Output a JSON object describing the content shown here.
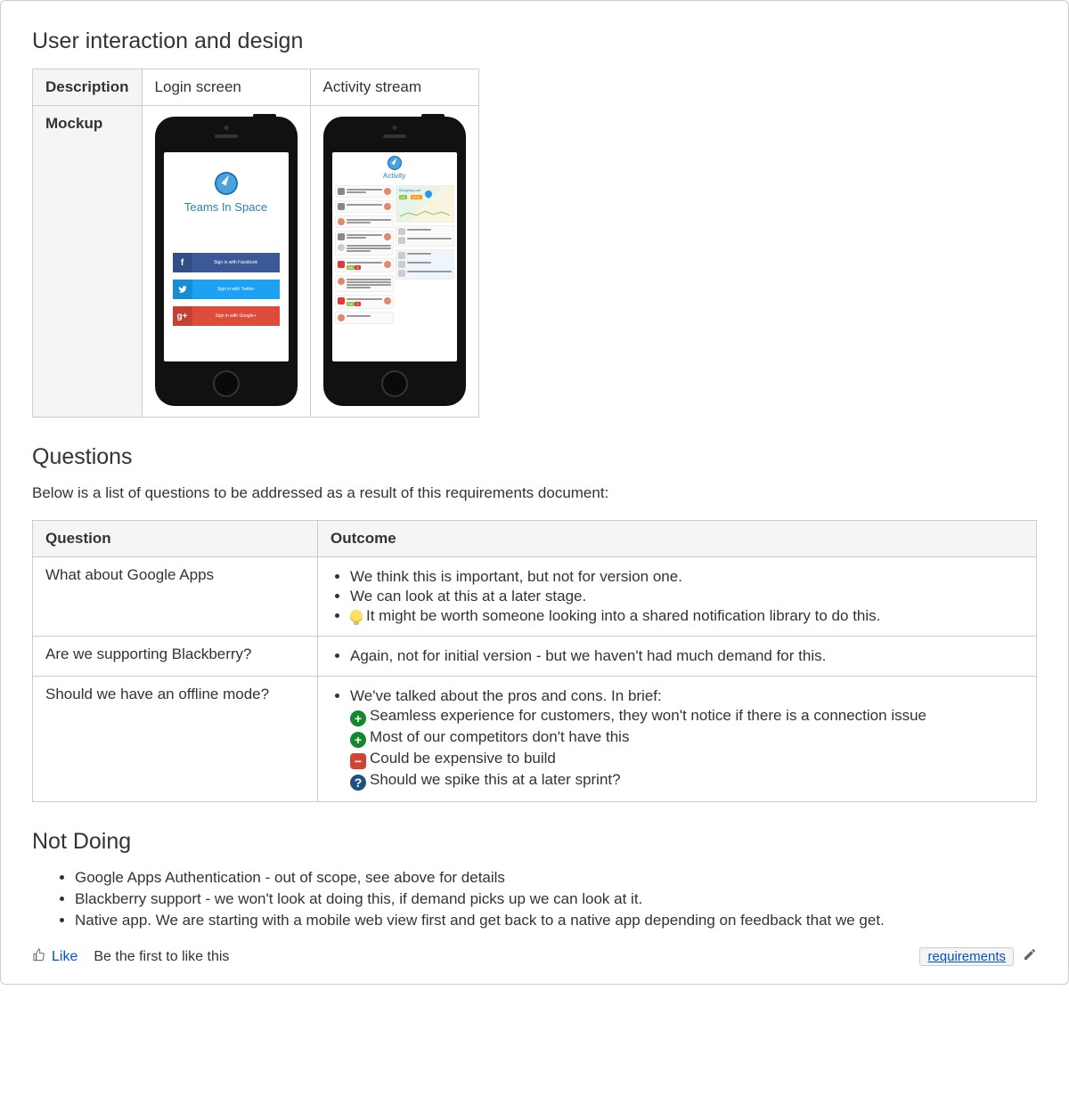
{
  "sections": {
    "design_heading": "User interaction and design",
    "questions_heading": "Questions",
    "questions_intro": "Below is a list of questions to be addressed as a result of this requirements document:",
    "notdoing_heading": "Not Doing"
  },
  "design_table": {
    "row_labels": {
      "description": "Description",
      "mockup": "Mockup"
    },
    "columns": [
      {
        "description": "Login screen"
      },
      {
        "description": "Activity stream"
      }
    ]
  },
  "login_mock": {
    "app_title": "Teams In Space",
    "buttons": {
      "fb": "Sign in with Facebook",
      "tw": "Sign in with Twitter",
      "gp": "Sign in with Google+"
    }
  },
  "activity_mock": {
    "title": "Activity",
    "map_title": "Shopping cart"
  },
  "questions_table": {
    "headers": {
      "question": "Question",
      "outcome": "Outcome"
    },
    "rows": [
      {
        "question": "What about Google Apps",
        "items": [
          {
            "type": "plain",
            "text": "We think this is important, but not for version one."
          },
          {
            "type": "plain",
            "text": "We can look at this at a later stage."
          },
          {
            "type": "bulb",
            "text": "It might be worth someone looking into a shared notification library to do this."
          }
        ]
      },
      {
        "question": "Are we supporting Blackberry?",
        "items": [
          {
            "type": "plain",
            "text": "Again, not for initial version - but we haven't had much demand for this."
          }
        ]
      },
      {
        "question": "Should we have an offline mode?",
        "items": [
          {
            "type": "plain",
            "text": "We've talked about the pros and cons. In brief:",
            "sub": [
              {
                "type": "plus",
                "text": "Seamless experience for customers, they won't notice if there is a connection issue"
              },
              {
                "type": "plus",
                "text": "Most of our competitors don't have this"
              },
              {
                "type": "minus",
                "text": "Could be expensive to build"
              },
              {
                "type": "q",
                "text": "Should we spike this at a later sprint?"
              }
            ]
          }
        ]
      }
    ]
  },
  "not_doing": [
    "Google Apps Authentication - out of scope, see above for details",
    "Blackberry support - we won't look at doing this, if demand picks up we can look at it.",
    "Native app. We are starting with a mobile web view first and get back to a native app depending on feedback that we get."
  ],
  "footer": {
    "like": "Like",
    "be_first": "Be the first to like this",
    "tag": "requirements"
  }
}
